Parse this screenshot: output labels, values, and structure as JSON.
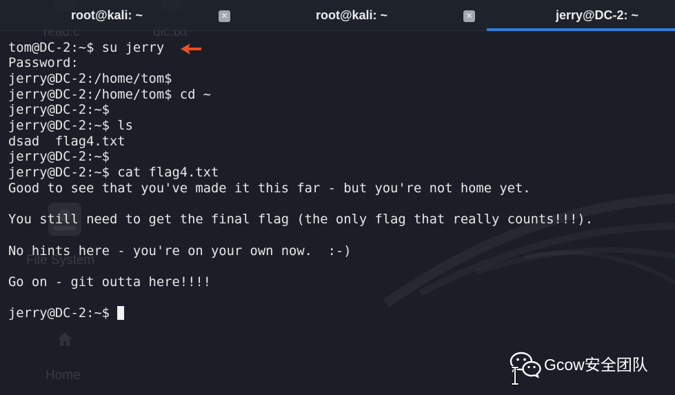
{
  "tabs": [
    {
      "label": "root@kali: ~",
      "active": false,
      "closable": true
    },
    {
      "label": "root@kali: ~",
      "active": false,
      "closable": true
    },
    {
      "label": "jerry@DC-2: ~",
      "active": true,
      "closable": false
    }
  ],
  "terminal": {
    "lines": [
      "tom@DC-2:~$ su jerry",
      "Password: ",
      "jerry@DC-2:/home/tom$",
      "jerry@DC-2:/home/tom$ cd ~",
      "jerry@DC-2:~$",
      "jerry@DC-2:~$ ls",
      "dsad  flag4.txt",
      "jerry@DC-2:~$",
      "jerry@DC-2:~$ cat flag4.txt",
      "Good to see that you've made it this far - but you're not home yet.",
      "",
      "You still need to get the final flag (the only flag that really counts!!!).",
      "",
      "No hints here - you're on your own now.  :-)",
      "",
      "Go on - git outta here!!!!",
      "",
      "jerry@DC-2:~$ "
    ]
  },
  "annotation": {
    "icon": "arrow-left-icon"
  },
  "desktop": {
    "icons": [
      {
        "label": "read.c",
        "icon": "file-icon"
      },
      {
        "label": "dic.txt",
        "icon": "file-icon"
      },
      {
        "label": "File System",
        "icon": "drive-icon"
      },
      {
        "label": "Home",
        "icon": "home-icon"
      }
    ]
  },
  "watermark": {
    "icon": "wechat-icon",
    "text": "Gcow安全团队"
  },
  "colors": {
    "background": "#1b1e27",
    "tab_bar": "#1f232c",
    "text": "#e8e8e8",
    "active_tab_accent": "#2f80de",
    "close_button": "#a3a6ab",
    "arrow": "#f04e23"
  }
}
